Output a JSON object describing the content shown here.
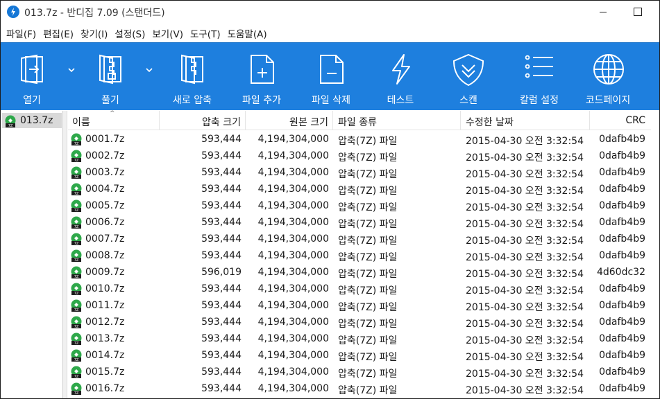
{
  "window": {
    "title": "013.7z - 반디집 7.09 (스탠더드)"
  },
  "menu": [
    "파일(F)",
    "편집(E)",
    "찾기(I)",
    "설정(S)",
    "보기(V)",
    "도구(T)",
    "도움말(A)"
  ],
  "toolbar": {
    "open": "열기",
    "extract": "풀기",
    "new_archive": "새로 압축",
    "add_file": "파일 추가",
    "delete_file": "파일 삭제",
    "test": "테스트",
    "scan": "스캔",
    "column_settings": "칼럼 설정",
    "codepage": "코드페이지"
  },
  "tree": {
    "root": "013.7z"
  },
  "columns": {
    "name": "이름",
    "packed": "압축 크기",
    "original": "원본 크기",
    "type": "파일 종류",
    "modified": "수정한 날짜",
    "crc": "CRC"
  },
  "files": [
    {
      "name": "0001.7z",
      "packed": "593,444",
      "original": "4,194,304,000",
      "type": "압축(7Z) 파일",
      "modified": "2015-04-30 오전 3:32:54",
      "crc": "0dafb4b9"
    },
    {
      "name": "0002.7z",
      "packed": "593,444",
      "original": "4,194,304,000",
      "type": "압축(7Z) 파일",
      "modified": "2015-04-30 오전 3:32:54",
      "crc": "0dafb4b9"
    },
    {
      "name": "0003.7z",
      "packed": "593,444",
      "original": "4,194,304,000",
      "type": "압축(7Z) 파일",
      "modified": "2015-04-30 오전 3:32:54",
      "crc": "0dafb4b9"
    },
    {
      "name": "0004.7z",
      "packed": "593,444",
      "original": "4,194,304,000",
      "type": "압축(7Z) 파일",
      "modified": "2015-04-30 오전 3:32:54",
      "crc": "0dafb4b9"
    },
    {
      "name": "0005.7z",
      "packed": "593,444",
      "original": "4,194,304,000",
      "type": "압축(7Z) 파일",
      "modified": "2015-04-30 오전 3:32:54",
      "crc": "0dafb4b9"
    },
    {
      "name": "0006.7z",
      "packed": "593,444",
      "original": "4,194,304,000",
      "type": "압축(7Z) 파일",
      "modified": "2015-04-30 오전 3:32:54",
      "crc": "0dafb4b9"
    },
    {
      "name": "0007.7z",
      "packed": "593,444",
      "original": "4,194,304,000",
      "type": "압축(7Z) 파일",
      "modified": "2015-04-30 오전 3:32:54",
      "crc": "0dafb4b9"
    },
    {
      "name": "0008.7z",
      "packed": "593,444",
      "original": "4,194,304,000",
      "type": "압축(7Z) 파일",
      "modified": "2015-04-30 오전 3:32:54",
      "crc": "0dafb4b9"
    },
    {
      "name": "0009.7z",
      "packed": "596,019",
      "original": "4,194,304,000",
      "type": "압축(7Z) 파일",
      "modified": "2015-04-30 오전 3:32:54",
      "crc": "4d60dc32"
    },
    {
      "name": "0010.7z",
      "packed": "593,444",
      "original": "4,194,304,000",
      "type": "압축(7Z) 파일",
      "modified": "2015-04-30 오전 3:32:54",
      "crc": "0dafb4b9"
    },
    {
      "name": "0011.7z",
      "packed": "593,444",
      "original": "4,194,304,000",
      "type": "압축(7Z) 파일",
      "modified": "2015-04-30 오전 3:32:54",
      "crc": "0dafb4b9"
    },
    {
      "name": "0012.7z",
      "packed": "593,444",
      "original": "4,194,304,000",
      "type": "압축(7Z) 파일",
      "modified": "2015-04-30 오전 3:32:54",
      "crc": "0dafb4b9"
    },
    {
      "name": "0013.7z",
      "packed": "593,444",
      "original": "4,194,304,000",
      "type": "압축(7Z) 파일",
      "modified": "2015-04-30 오전 3:32:54",
      "crc": "0dafb4b9"
    },
    {
      "name": "0014.7z",
      "packed": "593,444",
      "original": "4,194,304,000",
      "type": "압축(7Z) 파일",
      "modified": "2015-04-30 오전 3:32:54",
      "crc": "0dafb4b9"
    },
    {
      "name": "0015.7z",
      "packed": "593,444",
      "original": "4,194,304,000",
      "type": "압축(7Z) 파일",
      "modified": "2015-04-30 오전 3:32:54",
      "crc": "0dafb4b9"
    },
    {
      "name": "0016.7z",
      "packed": "593,444",
      "original": "4,194,304,000",
      "type": "압축(7Z) 파일",
      "modified": "2015-04-30 오전 3:32:54",
      "crc": "0dafb4b9"
    }
  ],
  "colors": {
    "toolbar_bg": "#1e7fde",
    "icon_stroke": "#ffffff",
    "archive_icon_green": "#2ea84a"
  },
  "icons": {
    "app": "bandizip-icon",
    "archive_file": "7z-archive-icon"
  }
}
